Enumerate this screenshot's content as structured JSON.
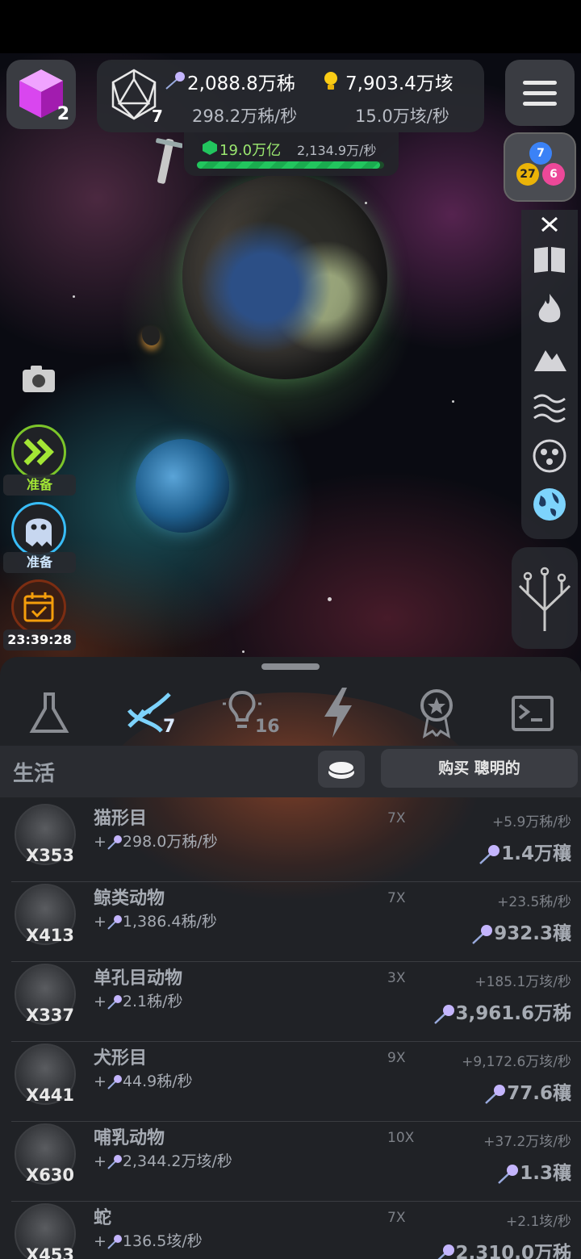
{
  "top": {
    "cube_count": "2",
    "level": "7",
    "resource_1_value": "2,088.8万秭",
    "resource_1_rate": "298.2万秭/秒",
    "resource_2_value": "7,903.4万垓",
    "resource_2_rate": "15.0万垓/秒"
  },
  "progress": {
    "amount": "19.0万亿",
    "rate": "2,134.9万/秒",
    "fill_fraction": 0.98
  },
  "atoms": {
    "a": "7",
    "b": "27",
    "c": "6"
  },
  "left": {
    "ready_1": "准备",
    "ready_2": "准备",
    "timer": "23:39:28"
  },
  "tabs": {
    "dna_badge": "7",
    "idea_badge": "16"
  },
  "section": {
    "title": "生活",
    "buy_label": "购买 聰明的"
  },
  "rows": [
    {
      "count": "X353",
      "name": "猫形目",
      "prod": "298.0万秭/秒",
      "mult": "7X",
      "gain": "+5.9万秭/秒",
      "cost": "1.4万穰"
    },
    {
      "count": "X413",
      "name": "鲸类动物",
      "prod": "1,386.4秭/秒",
      "mult": "7X",
      "gain": "+23.5秭/秒",
      "cost": "932.3穰"
    },
    {
      "count": "X337",
      "name": "单孔目动物",
      "prod": "2.1秭/秒",
      "mult": "3X",
      "gain": "+185.1万垓/秒",
      "cost": "3,961.6万秭"
    },
    {
      "count": "X441",
      "name": "犬形目",
      "prod": "44.9秭/秒",
      "mult": "9X",
      "gain": "+9,172.6万垓/秒",
      "cost": "77.6穰"
    },
    {
      "count": "X630",
      "name": "哺乳动物",
      "prod": "2,344.2万垓/秒",
      "mult": "10X",
      "gain": "+37.2万垓/秒",
      "cost": "1.3穰"
    },
    {
      "count": "X453",
      "name": "蛇",
      "prod": "136.5垓/秒",
      "mult": "7X",
      "gain": "+2.1垓/秒",
      "cost": "2,310.0万秭"
    }
  ],
  "icons": {
    "cube": "magenta-cube-icon",
    "level": "d20-icon",
    "resource_1": "comet-icon",
    "resource_2": "bulb-icon",
    "menu": "hamburger-icon",
    "atoms": "atom-icon",
    "camera": "camera-icon",
    "fast_forward": "fast-forward-icon",
    "ghost": "ghost-icon",
    "calendar": "calendar-check-icon",
    "tree": "evolution-tree-icon",
    "tools": [
      "close-icon",
      "book-icon",
      "fire-icon",
      "mountain-icon",
      "water-waves-icon",
      "cells-icon",
      "globe-icon"
    ],
    "tabs": [
      "flask-icon",
      "dna-icon",
      "lightbulb-icon",
      "lightning-icon",
      "medal-icon",
      "terminal-icon"
    ]
  },
  "colors": {
    "accent_green": "#22c55e",
    "cube": "#d946ef",
    "globe_active": "#7dd3fc",
    "atom_blue": "#3b82f6",
    "atom_yellow": "#eab308",
    "atom_pink": "#ec4899"
  }
}
